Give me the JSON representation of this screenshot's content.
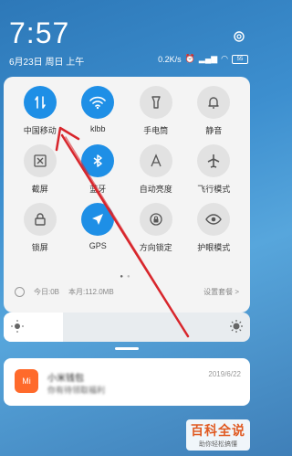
{
  "status_bar": {
    "time": "7:57",
    "date": "6月23日 周日 上午",
    "net_speed": "0.2K/s",
    "battery": "55"
  },
  "tiles": [
    {
      "label": "中国移动",
      "icon": "data-arrows-icon",
      "active": true
    },
    {
      "label": "klbb",
      "icon": "wifi-icon",
      "active": true
    },
    {
      "label": "手电筒",
      "icon": "flashlight-icon",
      "active": false
    },
    {
      "label": "静音",
      "icon": "bell-icon",
      "active": false
    },
    {
      "label": "截屏",
      "icon": "scissors-icon",
      "active": false
    },
    {
      "label": "蓝牙",
      "icon": "bluetooth-icon",
      "active": true
    },
    {
      "label": "自动亮度",
      "icon": "auto-brightness-icon",
      "active": false
    },
    {
      "label": "飞行模式",
      "icon": "airplane-icon",
      "active": false
    },
    {
      "label": "锁屏",
      "icon": "lock-icon",
      "active": false
    },
    {
      "label": "GPS",
      "icon": "gps-icon",
      "active": true
    },
    {
      "label": "方向锁定",
      "icon": "rotation-lock-icon",
      "active": false
    },
    {
      "label": "护眼模式",
      "icon": "eye-icon",
      "active": false
    }
  ],
  "data_usage": {
    "today": "今日:0B",
    "month": "本月:112.0MB",
    "settings_link": "设置套餐 >"
  },
  "brightness": {
    "level": 0.24
  },
  "notification": {
    "app_icon_text": "Mi",
    "title": "小米钱包",
    "body": "你有待领取福利",
    "date": "2019/6/22"
  },
  "watermark": {
    "title": "百科全说",
    "subtitle": "助你轻松搞懂"
  },
  "colors": {
    "accent": "#1e8fe6",
    "annotation_arrow": "#d8262c"
  }
}
